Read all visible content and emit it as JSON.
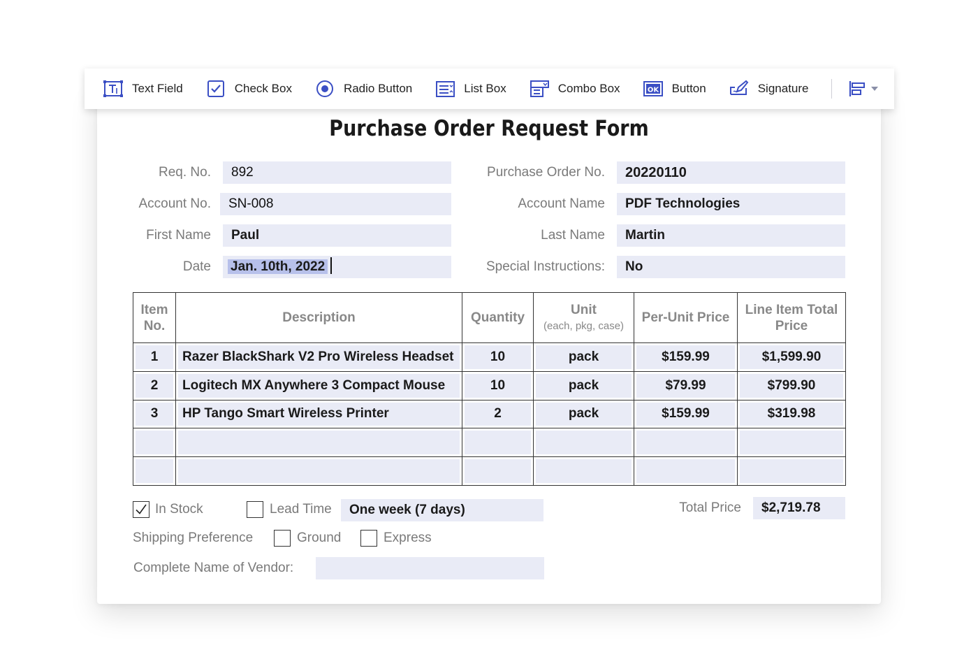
{
  "toolbar": {
    "items": [
      {
        "label": "Text Field",
        "icon": "text-field-icon"
      },
      {
        "label": "Check Box",
        "icon": "check-box-icon"
      },
      {
        "label": "Radio Button",
        "icon": "radio-button-icon"
      },
      {
        "label": "List Box",
        "icon": "list-box-icon"
      },
      {
        "label": "Combo Box",
        "icon": "combo-box-icon"
      },
      {
        "label": "Button",
        "icon": "button-icon"
      },
      {
        "label": "Signature",
        "icon": "signature-icon"
      }
    ],
    "align_icon": "align-left-icon",
    "accent": "#3b4fc4"
  },
  "form": {
    "title": "Purchase Order Request Form",
    "req_no": {
      "label": "Req. No.",
      "value": "892"
    },
    "po_no": {
      "label": "Purchase Order No.",
      "value": "20220110"
    },
    "account_no": {
      "label": "Account No.",
      "value": "SN-008"
    },
    "account_name": {
      "label": "Account Name",
      "value": "PDF Technologies"
    },
    "first_name": {
      "label": "First Name",
      "value": "Paul"
    },
    "last_name": {
      "label": "Last Name",
      "value": "Martin"
    },
    "date": {
      "label": "Date",
      "value": "Jan. 10th, 2022"
    },
    "special": {
      "label": "Special Instructions:",
      "value": "No"
    }
  },
  "table": {
    "headers": {
      "item_no": "Item No.",
      "description": "Description",
      "quantity": "Quantity",
      "unit": "Unit",
      "unit_sub": "(each, pkg, case)",
      "per_unit": "Per-Unit Price",
      "line_total": "Line Item Total Price"
    },
    "rows": [
      {
        "item": "1",
        "description": "Razer BlackShark V2 Pro Wireless Headset",
        "quantity": "10",
        "unit": "pack",
        "price": "$159.99",
        "total": "$1,599.90"
      },
      {
        "item": "2",
        "description": "Logitech MX Anywhere 3 Compact Mouse",
        "quantity": "10",
        "unit": "pack",
        "price": "$79.99",
        "total": "$799.90"
      },
      {
        "item": "3",
        "description": "HP Tango Smart Wireless Printer",
        "quantity": "2",
        "unit": "pack",
        "price": "$159.99",
        "total": "$319.98"
      },
      {
        "item": "",
        "description": "",
        "quantity": "",
        "unit": "",
        "price": "",
        "total": ""
      },
      {
        "item": "",
        "description": "",
        "quantity": "",
        "unit": "",
        "price": "",
        "total": ""
      }
    ]
  },
  "footer": {
    "in_stock": {
      "label": "In Stock",
      "checked": true
    },
    "lead_time": {
      "label": "Lead Time",
      "checked": false,
      "value": "One week (7 days)"
    },
    "total": {
      "label": "Total Price",
      "value": "$2,719.78"
    },
    "shipping": {
      "label": "Shipping Preference"
    },
    "ground": {
      "label": "Ground",
      "checked": false
    },
    "express": {
      "label": "Express",
      "checked": false
    },
    "vendor": {
      "label": "Complete Name of Vendor:",
      "value": ""
    }
  }
}
